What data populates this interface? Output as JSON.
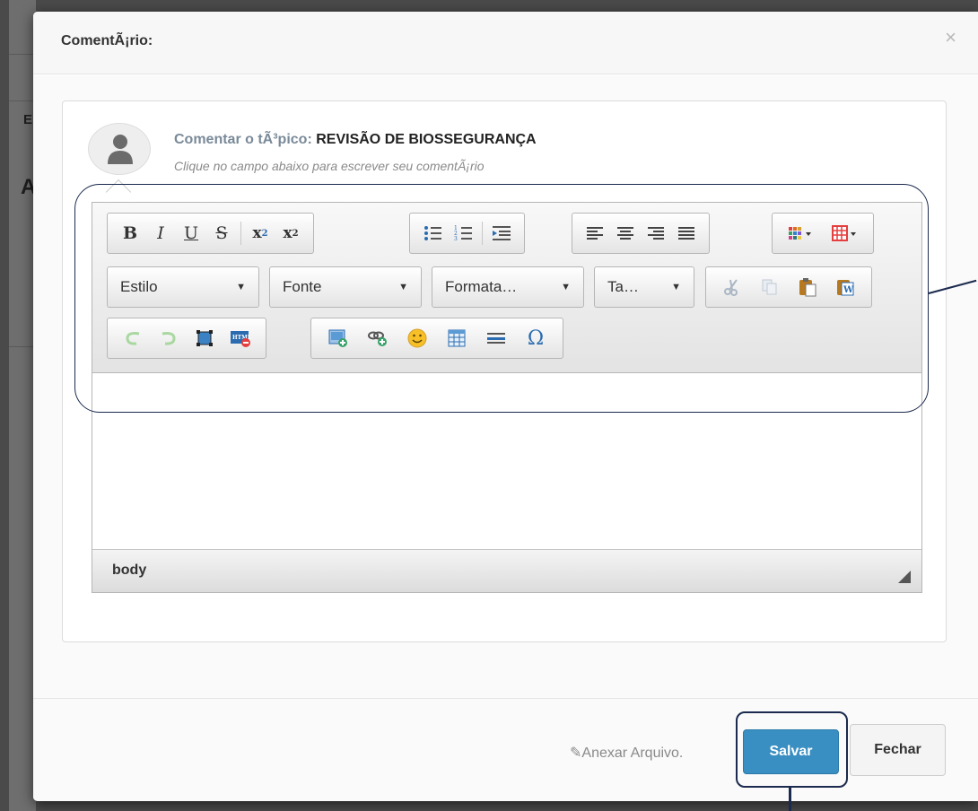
{
  "background": {
    "fragments": [
      "EL",
      "A"
    ]
  },
  "modal": {
    "title": "ComentÃ¡rio:",
    "close_symbol": "×",
    "heading_prefix": "Comentar o tÃ³pico:",
    "topic_name": "REVISÃO DE BIOSSEGURANÇA",
    "hint": "Clique no campo abaixo para escrever seu comentÃ¡rio"
  },
  "editor": {
    "toolbar_row1": [
      {
        "name": "bold-button",
        "icon": "B"
      },
      {
        "name": "italic-button",
        "icon": "I"
      },
      {
        "name": "underline-button",
        "icon": "U"
      },
      {
        "name": "strikethrough-button",
        "icon": "S"
      },
      {
        "name": "subscript-button",
        "icon": "x2-sub"
      },
      {
        "name": "superscript-button",
        "icon": "x2-sup"
      }
    ],
    "combos": {
      "style": "Estilo",
      "font": "Fonte",
      "format": "Formata…",
      "size": "Ta…"
    },
    "status_path": "body"
  },
  "footer": {
    "attach_label": "Anexar Arquivo.",
    "save_label": "Salvar",
    "close_label": "Fechar"
  },
  "colors": {
    "save_button": "#3a8fc2",
    "annotation": "#1b2a4e"
  }
}
